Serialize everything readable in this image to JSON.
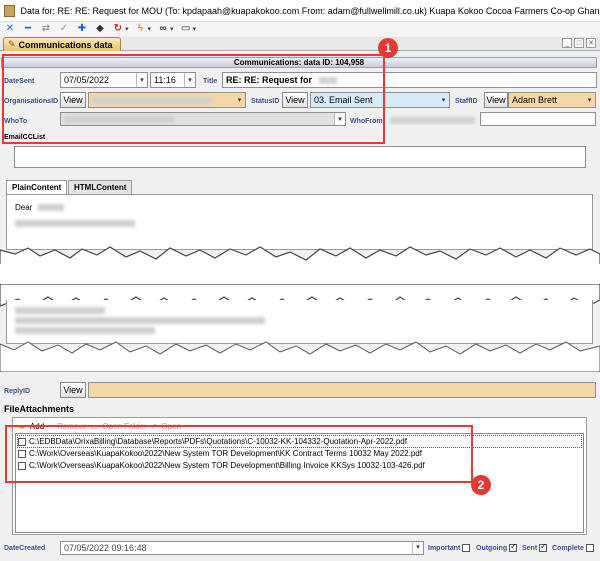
{
  "window": {
    "title": "Data for: RE: RE: Request for MOU (To: kpdapaah@kuapakokoo.com From: adam@fullwellmill.co.uk) Kuapa Kokoo Cocoa Farmers Co-op Ghana- Today"
  },
  "toolbar": {
    "icons": [
      "close-x-icon",
      "minus-icon",
      "link-icon",
      "check-icon",
      "plus-icon",
      "eraser-icon",
      "refresh-icon",
      "lightning-icon",
      "chain-icon",
      "card-icon"
    ]
  },
  "tab": {
    "label": "Communications data"
  },
  "header": {
    "text": "Communications: data ID: 104,958"
  },
  "fields": {
    "date_sent_label": "DateSent",
    "date_sent": "07/05/2022",
    "time_sent": "11:16",
    "title_label": "Title",
    "title_value": "RE: RE: Request for",
    "org_label": "OrganisationsID",
    "status_label": "StatusID",
    "status_value": "03. Email Sent",
    "staff_label": "StaffID",
    "staff_value": "Adam Brett",
    "view_label": "View",
    "who_to_label": "WhoTo",
    "who_from_label": "WhoFrom",
    "email_cc_label": "EmailCCList",
    "reply_label": "ReplyID"
  },
  "content_tabs": [
    "PlainContent",
    "HTMLContent"
  ],
  "content": {
    "greeting": "Dear"
  },
  "attachments": {
    "section_label": "FileAttachments",
    "tools": {
      "add": "Add",
      "remove": "Remove",
      "open_folder": "Open Folder",
      "open": "Open"
    },
    "files": [
      "C:\\EDBData\\OrixaBilling\\Database\\Reports\\PDFs\\Quotations\\C-10032-KK-104332-Quotation-Apr-2022.pdf",
      "C:\\Work\\Overseas\\KuapaKokoo\\2022\\New System TOR Development\\KK Contract Terms 10032 May 2022.pdf",
      "C:\\Work\\Overseas\\KuapaKokoo\\2022\\New System TOR Development\\Billing Invoice KKSys 10032-103-426.pdf"
    ]
  },
  "bottom": {
    "date_created_label": "DateCreated",
    "date_created": "07/05/2022 09:16:48",
    "important": "Important",
    "outgoing": "Outgoing",
    "sent": "Sent",
    "complete": "Complete"
  },
  "callouts": [
    "1",
    "2"
  ],
  "colors": {
    "callout": "#e53935",
    "label": "#3d4f86",
    "tab": "#e7c36a"
  }
}
